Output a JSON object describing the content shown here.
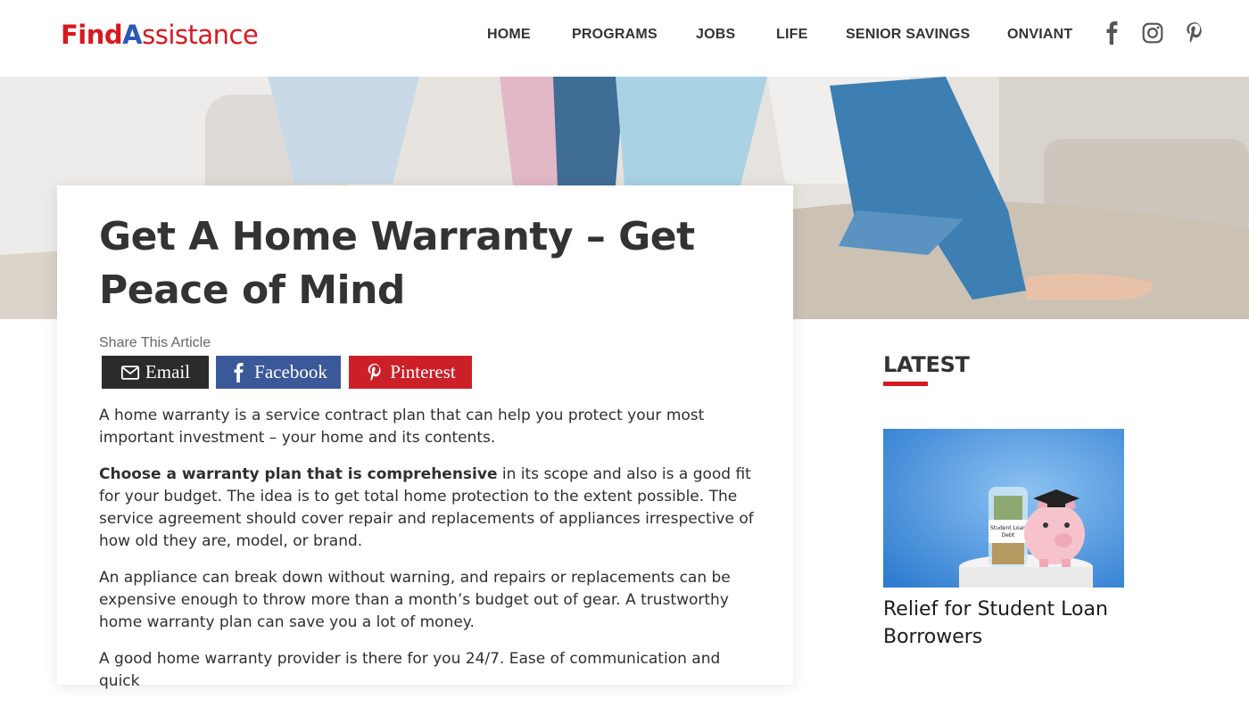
{
  "logo": {
    "find": "Find",
    "a": "A",
    "rest": "ssistance"
  },
  "nav": [
    "HOME",
    "PROGRAMS",
    "JOBS",
    "LIFE",
    "SENIOR SAVINGS",
    "ONVIANT"
  ],
  "social": [
    "facebook-icon",
    "instagram-icon",
    "pinterest-icon"
  ],
  "article": {
    "title": "Get A Home Warranty – Get Peace of Mind",
    "share_label": "Share This Article",
    "share": {
      "email": "Email",
      "facebook": "Facebook",
      "pinterest": "Pinterest"
    },
    "p1": "A home warranty is a service contract plan that can help you protect your most important investment – your home and its contents.",
    "p2_bold": "Choose a warranty plan that is comprehensive",
    "p2_rest": " in its scope and also is a good fit for your budget. The idea is to get total home protection to the extent possible. The service agreement should cover repair and replacements of appliances irrespective of how old they are, model, or brand.",
    "p3": "An appliance can break down without warning, and repairs or replacements can be expensive enough to throw more than a month’s budget out of gear. A trustworthy home warranty plan can save you a lot of money.",
    "p4": "A good home warranty provider is there for you 24/7. Ease of communication and quick"
  },
  "sidebar": {
    "heading": "LATEST",
    "item_title": "Relief for Student Loan Borrowers",
    "jar_label": "Student Loan Debt"
  },
  "colors": {
    "brand_red": "#d71920",
    "brand_blue": "#2a5ab7",
    "email_btn": "#2b2b2b",
    "facebook_btn": "#3b5998",
    "pinterest_btn": "#cb2027"
  }
}
